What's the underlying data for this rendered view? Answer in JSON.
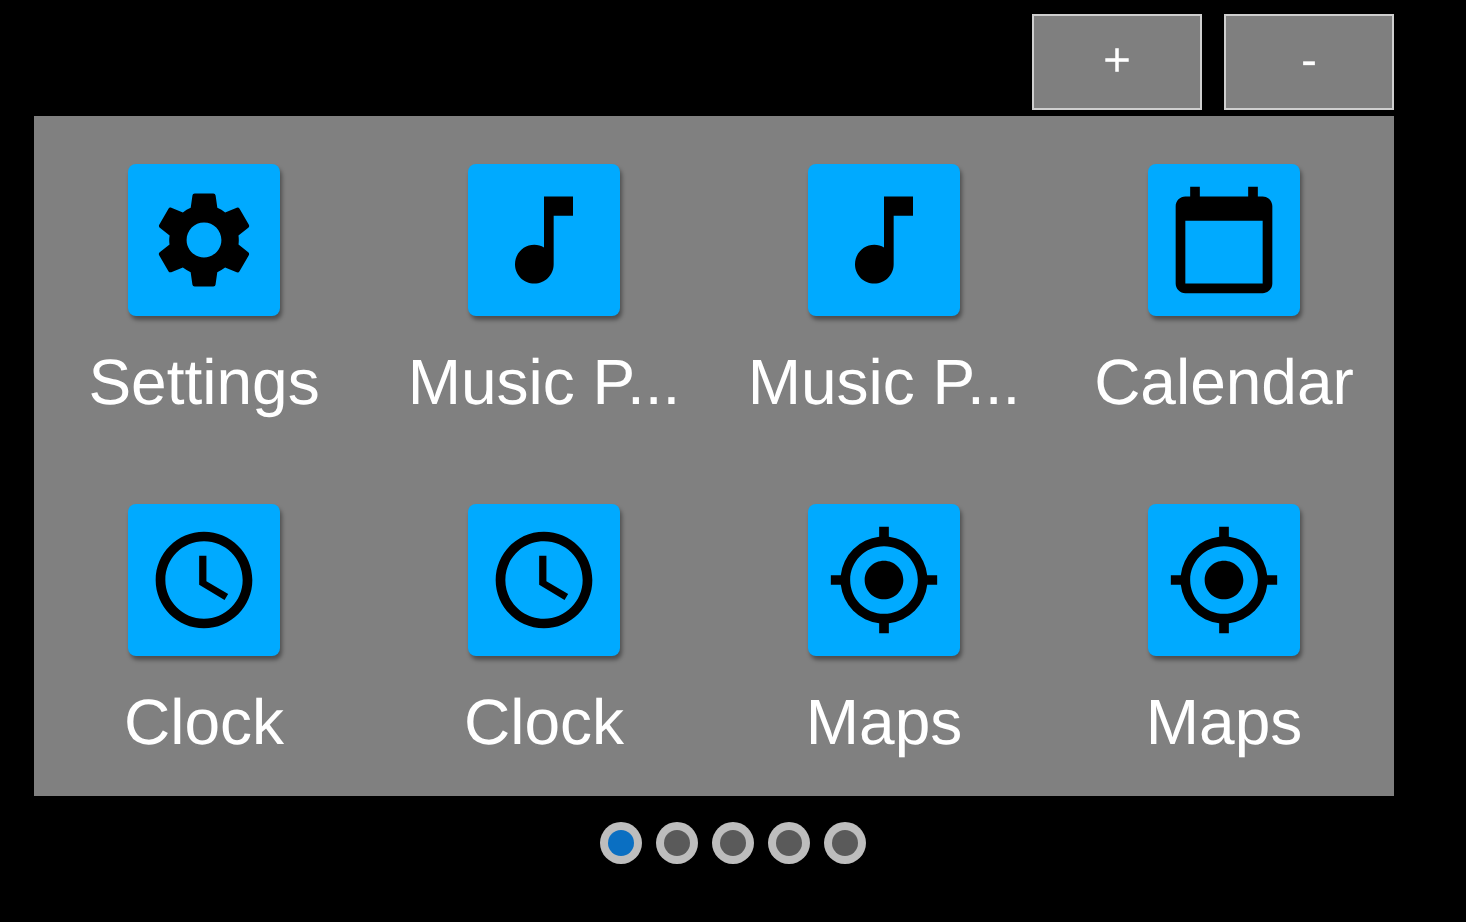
{
  "zoom_buttons": [
    "+",
    "-"
  ],
  "apps": [
    {
      "label": "Settings",
      "kind": "settings"
    },
    {
      "label": "Music P...",
      "kind": "music"
    },
    {
      "label": "Music P...",
      "kind": "music"
    },
    {
      "label": "Calendar",
      "kind": "calendar"
    },
    {
      "label": "Clock",
      "kind": "clock"
    },
    {
      "label": "Clock",
      "kind": "clock"
    },
    {
      "label": "Maps",
      "kind": "maps"
    },
    {
      "label": "Maps",
      "kind": "maps"
    }
  ],
  "pages": [
    {
      "selected": true
    },
    {
      "selected": false
    },
    {
      "selected": false
    },
    {
      "selected": false
    },
    {
      "selected": false
    }
  ]
}
